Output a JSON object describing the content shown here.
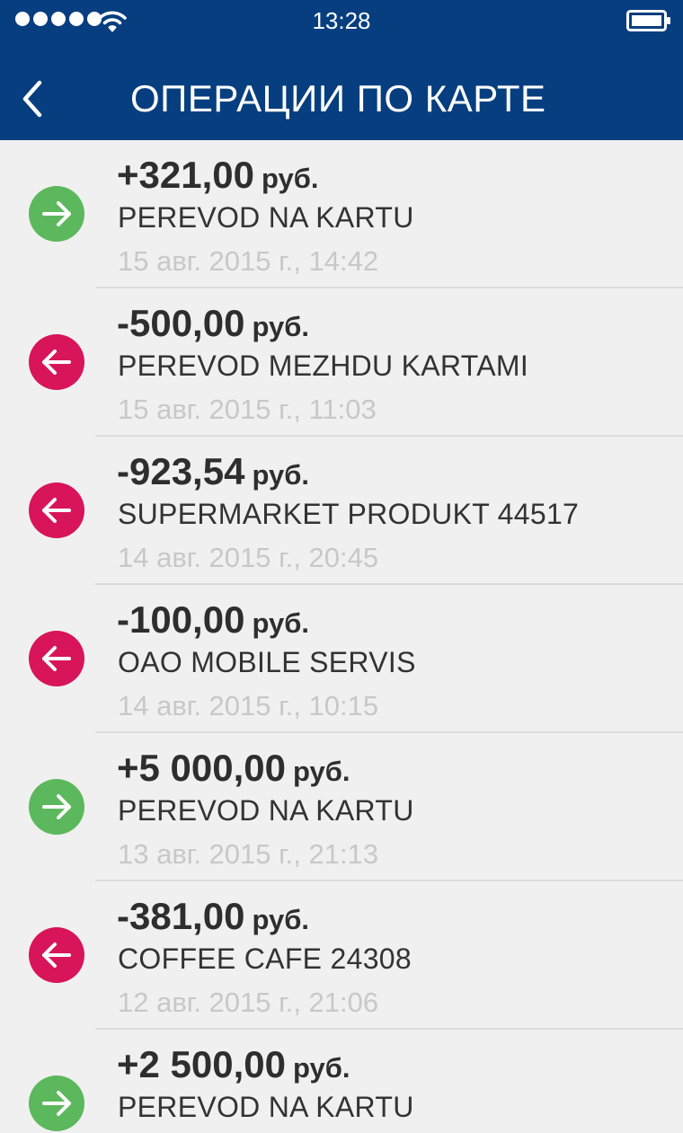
{
  "status_bar": {
    "time": "13:28",
    "signal_icon": "signal-dots-icon",
    "wifi_icon": "wifi-icon",
    "battery_icon": "battery-icon"
  },
  "nav": {
    "back_icon": "chevron-left-icon",
    "title": "ОПЕРАЦИИ ПО КАРТЕ"
  },
  "colors": {
    "header_bg": "#063e7f",
    "incoming": "#5cb85c",
    "outgoing": "#d8145a",
    "background": "#f0f0f0"
  },
  "transactions": [
    {
      "direction": "in",
      "icon": "arrow-right-icon",
      "amount": "+321,00",
      "currency": "руб.",
      "description": "PEREVOD NA KARTU",
      "datetime": "15 авг. 2015 г., 14:42"
    },
    {
      "direction": "out",
      "icon": "arrow-left-icon",
      "amount": "-500,00",
      "currency": "руб.",
      "description": "PEREVOD MEZHDU KARTAMI",
      "datetime": "15 авг. 2015 г., 11:03"
    },
    {
      "direction": "out",
      "icon": "arrow-left-icon",
      "amount": "-923,54",
      "currency": "руб.",
      "description": "SUPERMARKET PRODUKT 44517",
      "datetime": "14 авг. 2015 г., 20:45"
    },
    {
      "direction": "out",
      "icon": "arrow-left-icon",
      "amount": "-100,00",
      "currency": "руб.",
      "description": "OAO MOBILE SERVIS",
      "datetime": "14 авг. 2015 г., 10:15"
    },
    {
      "direction": "in",
      "icon": "arrow-right-icon",
      "amount": "+5 000,00",
      "currency": "руб.",
      "description": "PEREVOD NA KARTU",
      "datetime": "13 авг. 2015 г., 21:13"
    },
    {
      "direction": "out",
      "icon": "arrow-left-icon",
      "amount": "-381,00",
      "currency": "руб.",
      "description": "COFFEE CAFE 24308",
      "datetime": "12 авг. 2015 г., 21:06"
    },
    {
      "direction": "in",
      "icon": "arrow-right-icon",
      "amount": "+2 500,00",
      "currency": "руб.",
      "description": "PEREVOD NA KARTU",
      "datetime": ""
    }
  ]
}
